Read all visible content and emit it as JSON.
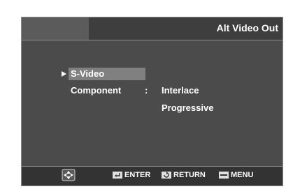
{
  "header": {
    "title": "Alt Video Out"
  },
  "menu": {
    "selected": "S-Video",
    "component_label": "Component",
    "separator": ":",
    "options": [
      "Interlace",
      "Progressive"
    ]
  },
  "footer": {
    "enter_label": "ENTER",
    "return_label": "RETURN",
    "menu_label": "MENU"
  },
  "colors": {
    "screen_bg": "#4b4b4b",
    "highlight": "#808080",
    "text": "#ffffff"
  }
}
